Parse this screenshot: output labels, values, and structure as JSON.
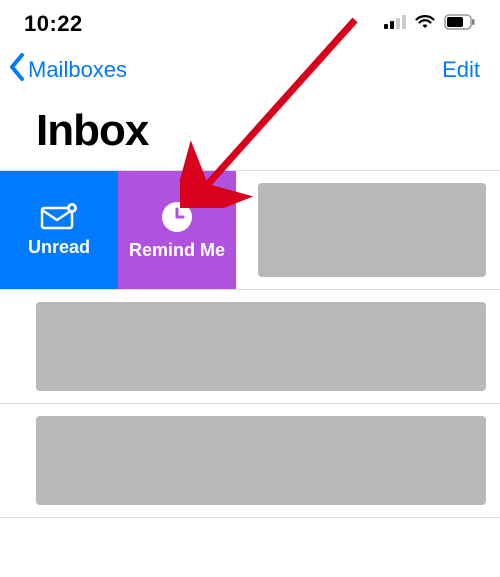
{
  "status": {
    "time": "10:22"
  },
  "nav": {
    "back_label": "Mailboxes",
    "edit_label": "Edit"
  },
  "title": "Inbox",
  "swipe_actions": {
    "unread_label": "Unread",
    "remind_label": "Remind Me"
  },
  "colors": {
    "accent_blue": "#007aff",
    "accent_purple": "#af52de",
    "placeholder_gray": "#b9b9b9"
  }
}
